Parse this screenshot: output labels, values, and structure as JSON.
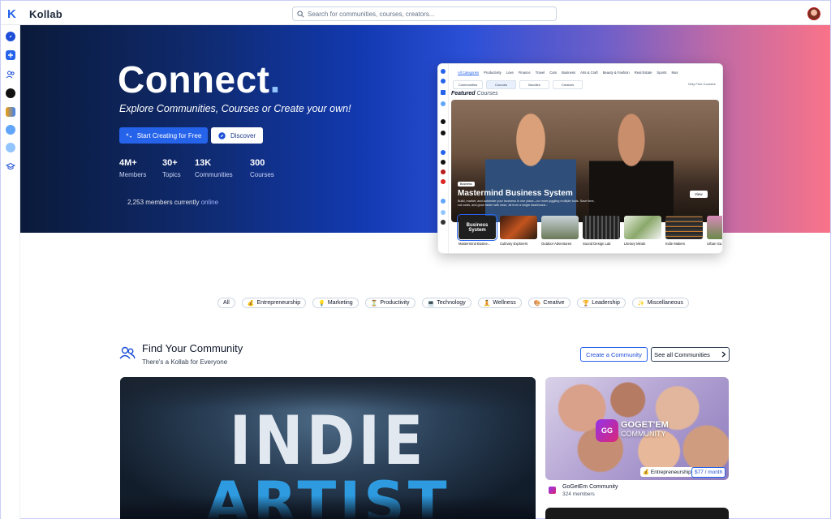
{
  "brand": {
    "name": "Kollab",
    "accent": "#2563eb"
  },
  "search": {
    "placeholder": "Search for communities, courses, creators..."
  },
  "hero": {
    "title": "Connect",
    "title_dot": ".",
    "subtitle": "Explore Communities, Courses or Create your own!",
    "primary_button": "Start Creating for Free",
    "secondary_button": "Discover",
    "stats": [
      {
        "value": "4M+",
        "label": "Members"
      },
      {
        "value": "30+",
        "label": "Topics"
      },
      {
        "value": "13K",
        "label": "Communities"
      },
      {
        "value": "300",
        "label": "Courses"
      }
    ],
    "online_count": "2,253 members currently",
    "online_word": "online"
  },
  "preview": {
    "categories": [
      "All Categories",
      "Productivity",
      "Love",
      "Finance",
      "Travel",
      "Cars",
      "Business",
      "Arts & Craft",
      "Beauty & Fashion",
      "Real Estate",
      "Sports",
      "Mus"
    ],
    "tabs": [
      "Communities",
      "Courses",
      "Bundles",
      "Creators"
    ],
    "free_toggle": "Only Free Courses",
    "featured_label": "Featured",
    "featured_word": "Courses",
    "hero_badge": "Business",
    "hero_title": "Mastermind Business System",
    "hero_desc": "Build, market, and automate your business in one place—no more juggling multiple tools. Save time, cut costs, and grow faster with ease, all from a single dashboard...",
    "view_button": "View",
    "thumbs": [
      {
        "label": "Mastermind Busine...",
        "color": "#1f1f1f"
      },
      {
        "label": "Culinary Explorers",
        "color": "#8a3b1c"
      },
      {
        "label": "Outdoor Adventures",
        "color": "#6b7a5a"
      },
      {
        "label": "Sound Design Lab",
        "color": "#2d2d2d"
      },
      {
        "label": "Literary Minds",
        "color": "#8aa86a"
      },
      {
        "label": "Indie Makers",
        "color": "#3a3a3a"
      },
      {
        "label": "Urban Ga",
        "color": "#8a5a7a"
      }
    ],
    "thumb_overlay": "Business System"
  },
  "chips": [
    {
      "icon": "",
      "label": "All"
    },
    {
      "icon": "💰",
      "label": "Entrepreneurship"
    },
    {
      "icon": "💡",
      "label": "Marketing"
    },
    {
      "icon": "⏳",
      "label": "Productivity"
    },
    {
      "icon": "💻",
      "label": "Technology"
    },
    {
      "icon": "🧘",
      "label": "Wellness"
    },
    {
      "icon": "🎨",
      "label": "Creative"
    },
    {
      "icon": "🏆",
      "label": "Leadership"
    },
    {
      "icon": "✨",
      "label": "Miscellaneous"
    }
  ],
  "find": {
    "title": "Find Your Community",
    "subtitle": "There's a Kollab for Everyone",
    "create_button": "Create a Community",
    "see_all_button": "See all Communities"
  },
  "big_card": {
    "line1": "INDIE",
    "line2": "ARTIST"
  },
  "small_card": {
    "logo_text": "GOGET'EM",
    "logo_sub": "COMMUNITY",
    "category": "💰 Entrepreneurship",
    "price": "$77 / month",
    "name": "GoGetEm Community",
    "members": "324 members"
  }
}
